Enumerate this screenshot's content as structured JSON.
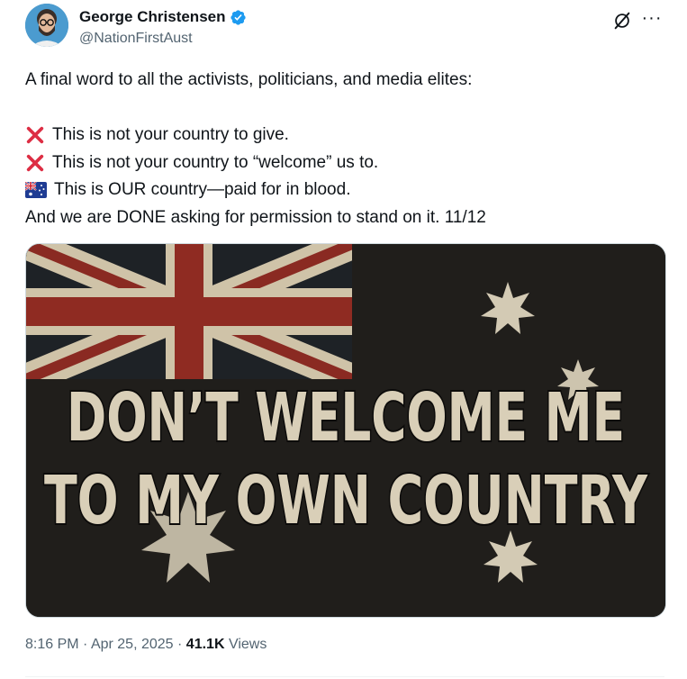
{
  "author": {
    "display_name": "George Christensen",
    "handle": "@NationFirstAust",
    "verified": true,
    "avatar_icon": "avatar-bearded-man-glasses"
  },
  "header_actions": {
    "grok_icon": "grok-icon",
    "more_icon": "more-icon",
    "more_label": "···"
  },
  "tweet": {
    "lines": [
      "A final word to all the activists, politicians, and media elites:",
      "",
      "This is not your country to give.",
      "This is not your country to “welcome” us to.",
      "This is OUR country—paid for in blood.",
      "And we are DONE asking for permission to stand on it. 11/12"
    ],
    "line_icons": [
      "",
      "",
      "cross-mark-icon",
      "cross-mark-icon",
      "australia-flag-icon",
      ""
    ]
  },
  "media": {
    "alt": "Australian flag poster",
    "headline_line1": "DON’T WELCOME ME",
    "headline_line2": "TO MY OWN COUNTRY"
  },
  "meta": {
    "time": "8:16 PM",
    "dot1": "·",
    "date": "Apr 25, 2025",
    "dot2": "·",
    "views_count": "41.1K",
    "views_label": "Views"
  },
  "colors": {
    "verified_blue": "#1d9bf0",
    "text_primary": "#0f1419",
    "text_secondary": "#536471",
    "cross_red": "#dd2e44",
    "poster_bg": "#1c1b18",
    "poster_text": "#d9cfb8"
  }
}
